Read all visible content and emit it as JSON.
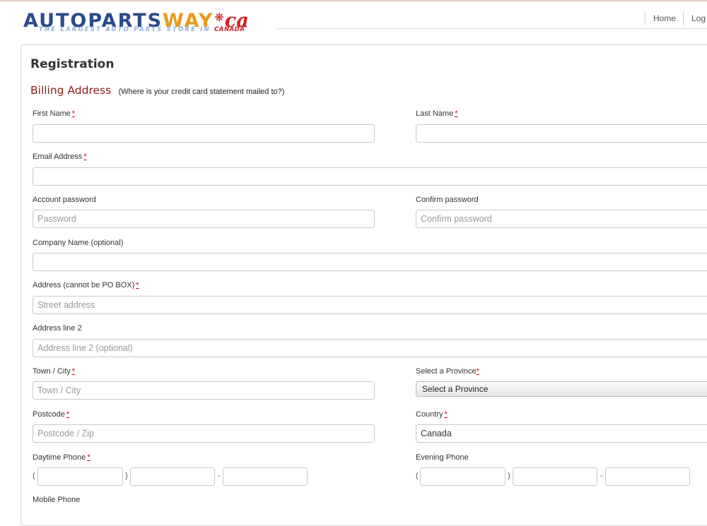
{
  "logo": {
    "part1": "AUTO",
    "part2": "PARTS",
    "part3": "WAY",
    "part4": "ca",
    "tagline": "THE LARGEST AUTO PARTS STORE IN",
    "tagline_country": "CANADA"
  },
  "nav": {
    "home": "Home",
    "login": "Log In"
  },
  "page": {
    "title": "Registration",
    "section_title": "Billing Address",
    "section_note": "(Where is your credit card statement mailed to?)"
  },
  "form": {
    "required_mark": "*",
    "first_name": {
      "label": "First Name",
      "value": ""
    },
    "last_name": {
      "label": "Last Name",
      "value": ""
    },
    "email": {
      "label": "Email Address",
      "value": ""
    },
    "password": {
      "label": "Account password",
      "placeholder": "Password"
    },
    "confirm_password": {
      "label": "Confirm password",
      "placeholder": "Confirm password"
    },
    "company": {
      "label": "Company Name (optional)",
      "value": ""
    },
    "address1": {
      "label": "Address (cannot be PO BOX)",
      "placeholder": "Street address"
    },
    "address2": {
      "label": "Address line 2",
      "placeholder": "Address line 2 (optional)"
    },
    "city": {
      "label": "Town / City",
      "placeholder": "Town / City"
    },
    "province": {
      "label": "Select a Province",
      "selected": "Select a Province"
    },
    "postcode": {
      "label": "Postcode",
      "placeholder": "Postcode / Zip"
    },
    "country": {
      "label": "Country",
      "value": "Canada"
    },
    "daytime_phone": {
      "label": "Daytime Phone"
    },
    "evening_phone": {
      "label": "Evening Phone"
    },
    "mobile_phone": {
      "label": "Mobile Phone"
    },
    "phone_open": "(",
    "phone_close": ")",
    "phone_dash": "-"
  },
  "colors": {
    "brand_blue": "#2a4b8c",
    "brand_orange": "#e89a1c",
    "brand_red": "#d11f1f",
    "section_heading": "#8b1a1a",
    "required": "#cc0000"
  }
}
